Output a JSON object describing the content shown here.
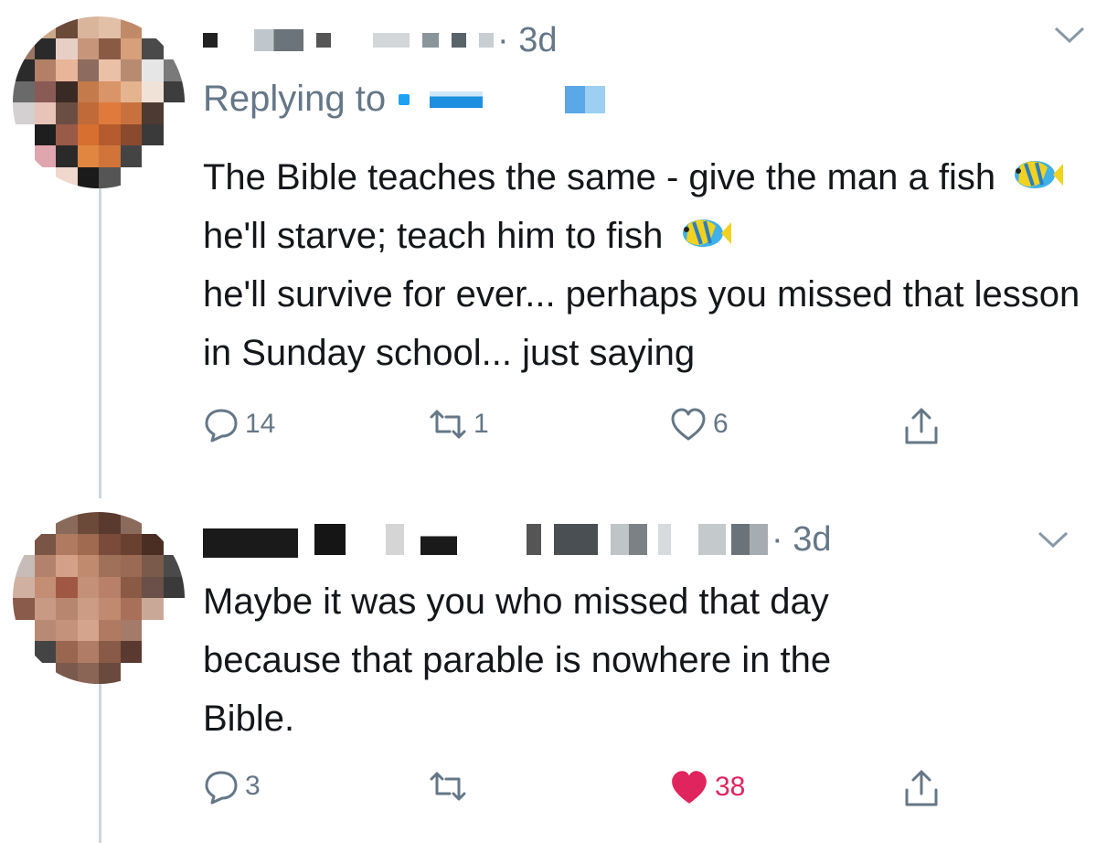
{
  "colors": {
    "text": "#14171a",
    "muted": "#657786",
    "like": "#e0245e",
    "line": "#ccd6dd"
  },
  "tweets": [
    {
      "time": "· 3d",
      "replying_label": "Replying to",
      "text": "The Bible teaches the same - give the man\na fish 🐠 he'll starve; teach him to fish 🐠\nhe'll survive for ever... perhaps you missed\nthat lesson in Sunday school... just saying",
      "text_parts": [
        "The Bible teaches the same - give the man a fish",
        "he'll starve; teach him to fish",
        "he'll survive for ever... perhaps you missed that lesson in Sunday school... just saying"
      ],
      "icons": {
        "reply": "reply-icon",
        "retweet": "retweet-icon",
        "like": "heart-outline-icon",
        "share": "share-icon"
      },
      "replies": "14",
      "retweets": "1",
      "likes": "6"
    },
    {
      "time": "· 3d",
      "text": "Maybe it was you who missed that day\nbecause that parable is nowhere in the\nBible.",
      "icons": {
        "reply": "reply-icon",
        "retweet": "retweet-icon",
        "like": "heart-filled-icon",
        "share": "share-icon"
      },
      "replies": "3",
      "retweets": "",
      "likes": "38"
    }
  ]
}
